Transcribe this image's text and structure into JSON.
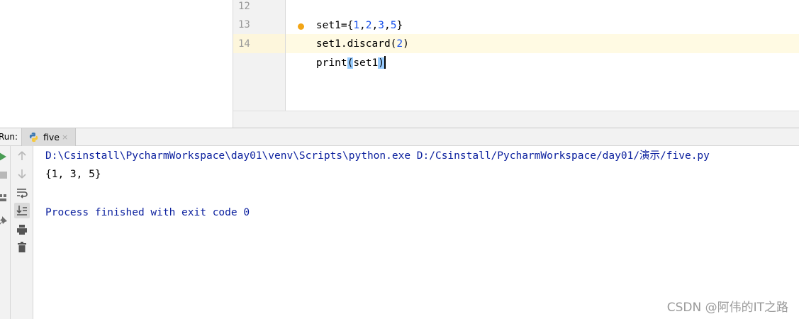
{
  "editor": {
    "lines": [
      {
        "number": "12",
        "parts": [
          {
            "t": "set1={",
            "c": "plain"
          },
          {
            "t": "1",
            "c": "num"
          },
          {
            "t": ",",
            "c": "plain"
          },
          {
            "t": "2",
            "c": "num"
          },
          {
            "t": ",",
            "c": "plain"
          },
          {
            "t": "3",
            "c": "num"
          },
          {
            "t": ",",
            "c": "plain"
          },
          {
            "t": "5",
            "c": "num"
          },
          {
            "t": "}",
            "c": "plain"
          }
        ]
      },
      {
        "number": "13",
        "parts": [
          {
            "t": "set1.discard(",
            "c": "plain"
          },
          {
            "t": "2",
            "c": "num"
          },
          {
            "t": ")",
            "c": "plain"
          }
        ]
      },
      {
        "number": "14",
        "parts": [
          {
            "t": "print",
            "c": "plain"
          },
          {
            "t": "(",
            "c": "brace"
          },
          {
            "t": "set1",
            "c": "plain"
          },
          {
            "t": ")",
            "c": "brace"
          }
        ]
      }
    ],
    "current_line": "14",
    "intention_icon": "lightbulb-icon"
  },
  "run": {
    "label": "Run:",
    "tab_label": "five",
    "tab_icon": "python-file-icon",
    "tab_close": "×",
    "console": {
      "command": "D:\\Csinstall\\PycharmWorkspace\\day01\\venv\\Scripts\\python.exe D:/Csinstall/PycharmWorkspace/day01/演示/five.py",
      "output": "{1, 3, 5}",
      "exit_message": "Process finished with exit code 0"
    },
    "toolbar_icons": [
      "rerun-icon",
      "stop-icon",
      "layout-icon",
      "pin-icon",
      "up-arrow-icon",
      "down-arrow-icon",
      "soft-wrap-icon",
      "scroll-to-end-icon",
      "print-icon",
      "trash-icon"
    ]
  },
  "colors": {
    "number": "#1750eb",
    "console_text": "#0a1f9e",
    "current_line_bg": "#fffae3",
    "brace_match": "#99ccff"
  },
  "watermark": "CSDN @阿伟的IT之路"
}
